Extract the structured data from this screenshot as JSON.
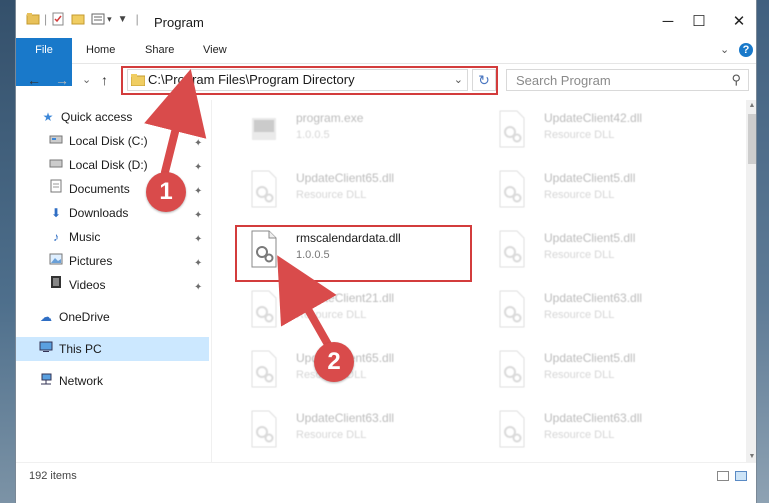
{
  "window": {
    "title": "Program",
    "minimize": "─",
    "maximize": "☐",
    "close": "✕"
  },
  "ribbon": {
    "tabs": [
      "File",
      "Home",
      "Share",
      "View"
    ],
    "help": "?",
    "expand": "⌄"
  },
  "navigation": {
    "back": "←",
    "forward": "→",
    "recent": "⌄",
    "up": "↑"
  },
  "address": {
    "path": "C:\\Program Files\\Program Directory",
    "dropdown": "⌄",
    "refresh": "↻"
  },
  "search": {
    "placeholder": "Search Program",
    "icon": "⚲"
  },
  "sidebar": {
    "quick_access": "Quick access",
    "items": [
      {
        "label": "Local Disk (C:)",
        "icon": "drive-icon"
      },
      {
        "label": "Local Disk (D:)",
        "icon": "drive-icon"
      },
      {
        "label": "Documents",
        "icon": "documents-icon"
      },
      {
        "label": "Downloads",
        "icon": "downloads-icon"
      },
      {
        "label": "Music",
        "icon": "music-icon"
      },
      {
        "label": "Pictures",
        "icon": "pictures-icon"
      },
      {
        "label": "Videos",
        "icon": "videos-icon"
      }
    ],
    "pin": "📌",
    "onedrive": "OneDrive",
    "this_pc": "This PC",
    "network": "Network"
  },
  "files": [
    {
      "name": "program.exe",
      "detail": "1.0.0.5",
      "faded": true
    },
    {
      "name": "UpdateClient42.dll",
      "detail": "Resource DLL",
      "faded": true
    },
    {
      "name": "UpdateClient65.dll",
      "detail": "Resource DLL",
      "faded": true
    },
    {
      "name": "UpdateClient5.dll",
      "detail": "Resource DLL",
      "faded": true
    },
    {
      "name": "rmscalendardata.dll",
      "detail": "1.0.0.5",
      "faded": false
    },
    {
      "name": "UpdateClient5.dll",
      "detail": "Resource DLL",
      "faded": true
    },
    {
      "name": "UpdateClient21.dll",
      "detail": "Resource DLL",
      "faded": true
    },
    {
      "name": "UpdateClient63.dll",
      "detail": "Resource DLL",
      "faded": true
    },
    {
      "name": "UpdateClient65.dll",
      "detail": "Resource DLL",
      "faded": true
    },
    {
      "name": "UpdateClient5.dll",
      "detail": "Resource DLL",
      "faded": true
    },
    {
      "name": "UpdateClient63.dll",
      "detail": "Resource DLL",
      "faded": true
    },
    {
      "name": "UpdateClient63.dll",
      "detail": "Resource DLL",
      "faded": true
    }
  ],
  "status": {
    "item_count": "192 items"
  },
  "callouts": {
    "step1": "1",
    "step2": "2"
  },
  "colors": {
    "accent": "#1979ca",
    "highlight": "#d33c3c",
    "selected": "#cce8ff"
  }
}
